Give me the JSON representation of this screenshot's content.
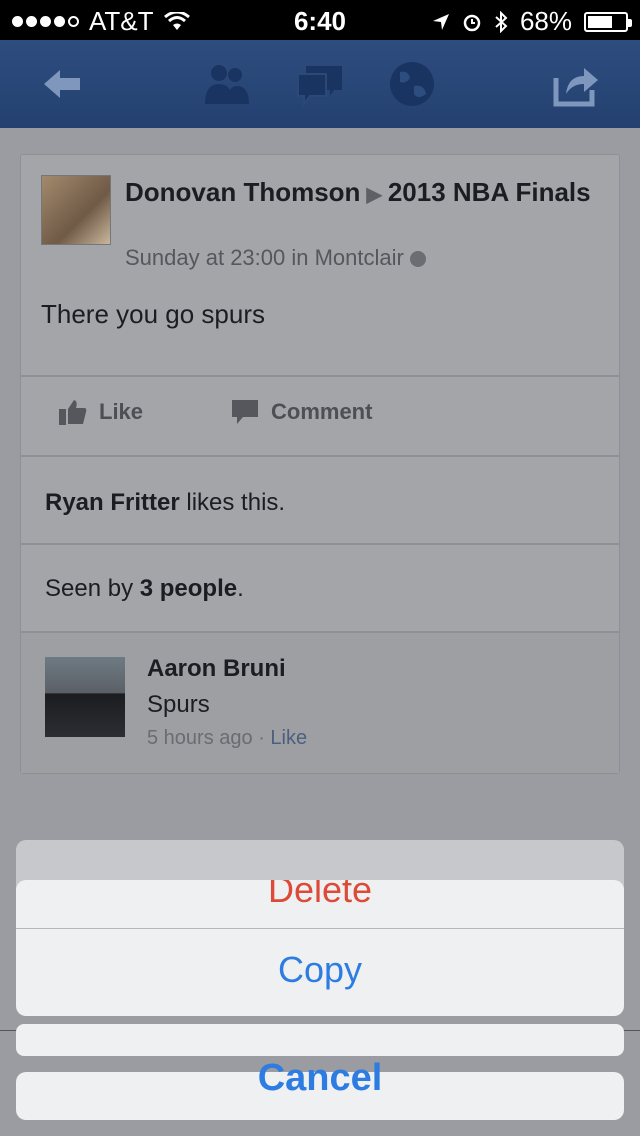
{
  "status": {
    "carrier": "AT&T",
    "time": "6:40",
    "battery": "68%",
    "battery_level": 0.68,
    "signal_filled": 4,
    "signal_total": 5
  },
  "nav": {
    "icons": [
      "back-arrow-icon",
      "friends-icon",
      "messages-icon",
      "globe-icon",
      "share-icon"
    ]
  },
  "post": {
    "author": "Donovan Thomson",
    "target": "2013 NBA Finals",
    "meta": "Sunday at 23:00 in Montclair",
    "text": "There you go spurs",
    "like_label": "Like",
    "comment_label": "Comment",
    "liker": "Ryan Fritter",
    "likes_suffix": " likes this.",
    "seen_prefix": "Seen by ",
    "seen_count": "3 people",
    "seen_suffix": "."
  },
  "comment": {
    "author": "Aaron Bruni",
    "text": "Spurs",
    "time": "5 hours ago",
    "sep": " · ",
    "like": "Like"
  },
  "action_sheet": {
    "delete": "Delete",
    "copy": "Copy",
    "cancel": "Cancel"
  },
  "colors": {
    "nav_bg": "#2e4d7f",
    "delete": "#dd4b38",
    "ios_blue": "#2d7ce2"
  }
}
